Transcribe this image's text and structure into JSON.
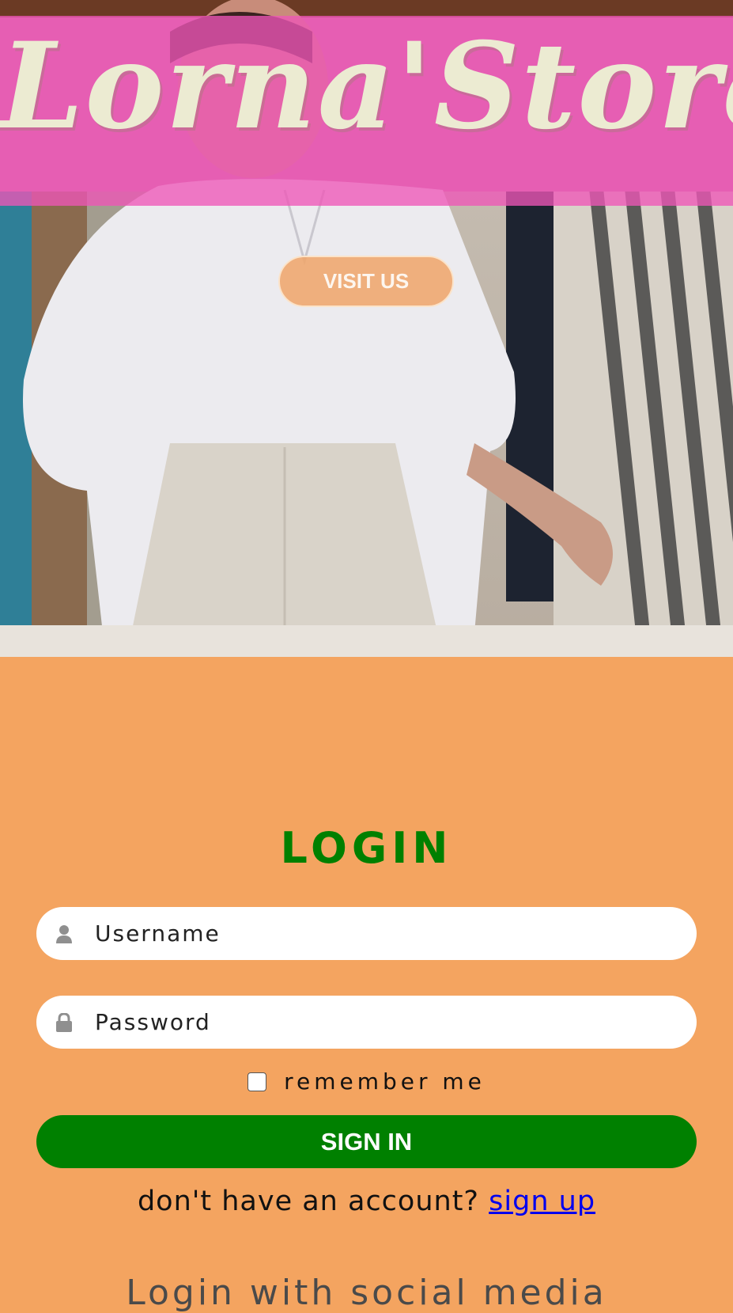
{
  "hero": {
    "brand_title": "Lorna'Store",
    "visit_button": "VISIT US"
  },
  "login": {
    "title": "LOGIN",
    "username_placeholder": "Username",
    "password_placeholder": "Password",
    "remember_label": "remember me",
    "remember_checked": false,
    "signin_button": "SIGN IN",
    "no_account_text": "don't have an account?",
    "signup_link": "sign up",
    "social_title": "Login with social media"
  },
  "icons": {
    "username": "user-icon",
    "password": "lock-icon"
  },
  "colors": {
    "page_background": "#f4a460",
    "banner": "#ee56b7",
    "login_title": "#008000",
    "signin_button": "#008000",
    "link": "#0000ee"
  }
}
